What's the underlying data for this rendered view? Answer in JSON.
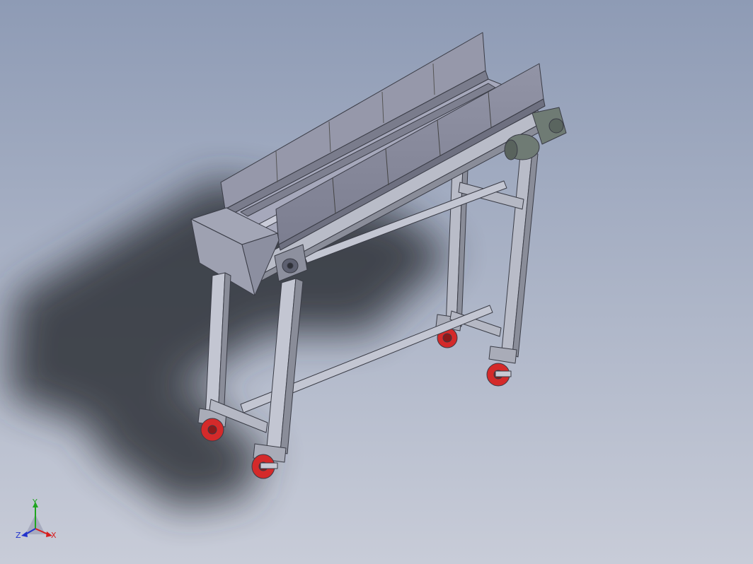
{
  "viewport": {
    "background_top": "#8e9bb5",
    "background_bottom": "#c8ccd8"
  },
  "model": {
    "name": "",
    "frame_color": "#b9bcc8",
    "frame_dark": "#80838f",
    "wheel_color": "#d42a2a",
    "motor_color": "#6f7b74"
  },
  "triad": {
    "x_label": "X",
    "y_label": "Y",
    "z_label": "Z",
    "x_color": "#d81e1e",
    "y_color": "#1fa51f",
    "z_color": "#2233cc"
  }
}
